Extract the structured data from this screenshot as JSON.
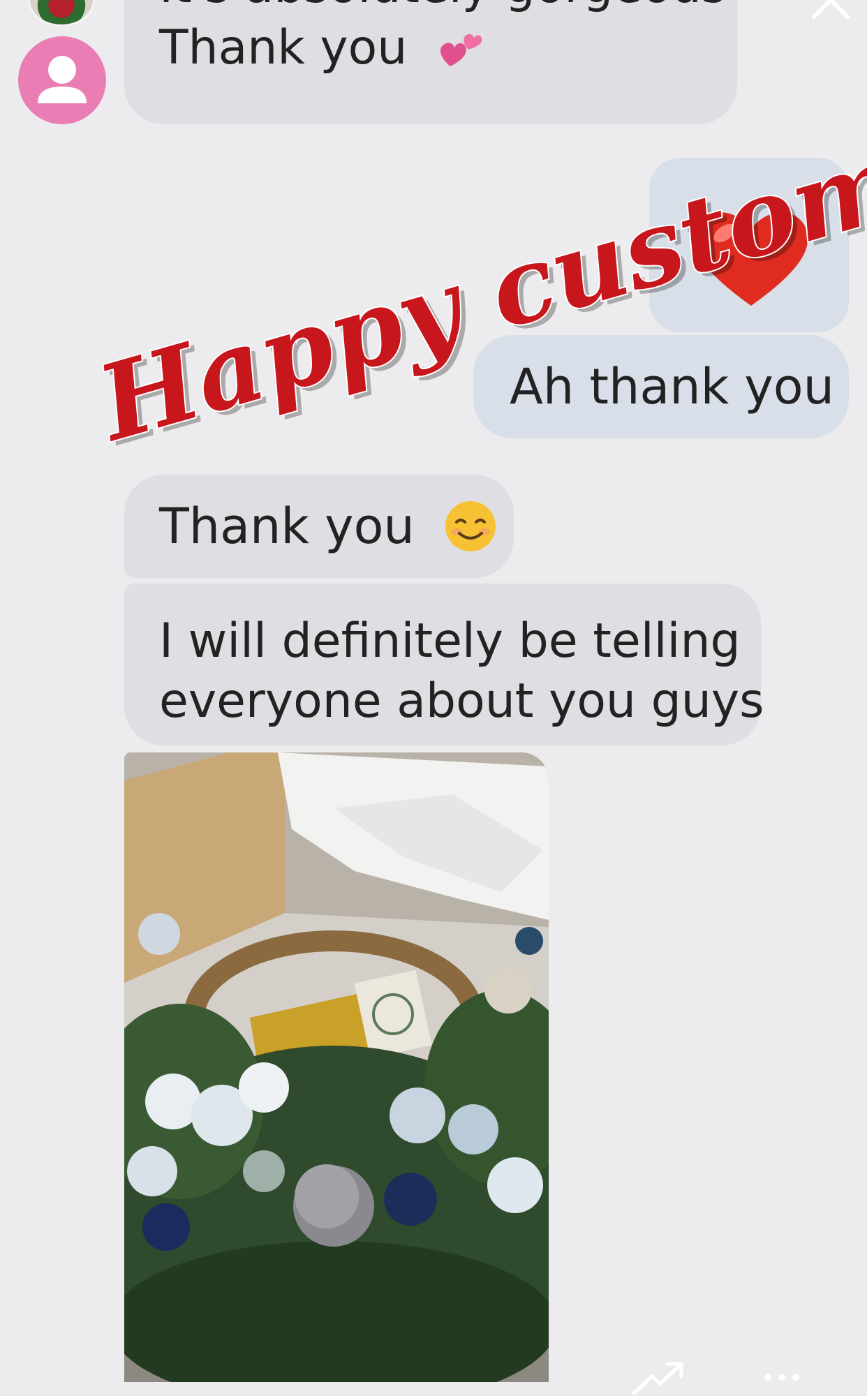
{
  "messages": {
    "received_1_line_1": "It's absolutely gorgeous",
    "received_1_line_2": "Thank you",
    "sent_1": "Ah thank you",
    "received_2": "Thank you",
    "received_3_line_1": "I will definitely be telling",
    "received_3_line_2": "everyone about you guys"
  },
  "overlay": {
    "title": "Happy customers",
    "color": "#c8161d"
  },
  "icons": {
    "story_avatar": "wreath-avatar-icon",
    "close": "close-icon",
    "contact": "person-avatar-icon",
    "two_hearts": "two-hearts-emoji-icon",
    "red_heart": "red-heart-emoji-icon",
    "smiling": "smiling-face-emoji-icon",
    "share": "trend-arrow-icon",
    "more": "more-dots-icon"
  },
  "colors": {
    "background": "#ececee",
    "received_bubble": "#dfdfe3",
    "sent_bubble": "#d9dfe9",
    "avatar_pink": "#ea7eb4"
  }
}
